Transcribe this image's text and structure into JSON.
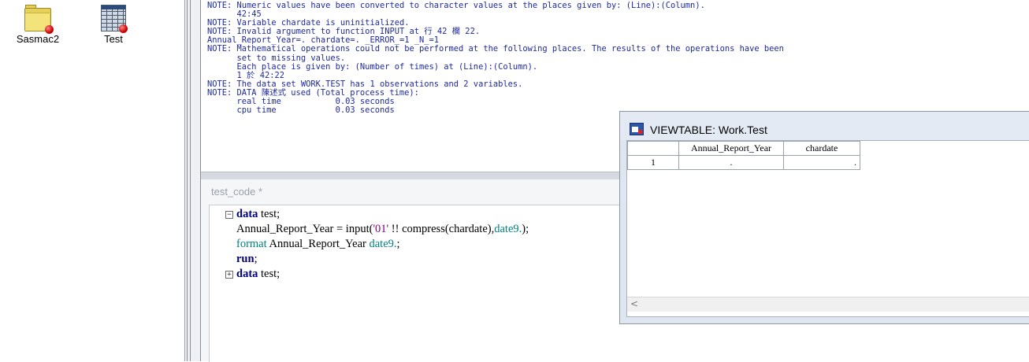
{
  "explorer": {
    "items": [
      {
        "label": "Sasmac2",
        "icon": "folder-library-icon"
      },
      {
        "label": "Test",
        "icon": "table-dataset-icon"
      }
    ]
  },
  "log": {
    "lines": [
      "NOTE: Numeric values have been converted to character values at the places given by: (Line):(Column).",
      "      42:45",
      "NOTE: Variable chardate is uninitialized.",
      "NOTE: Invalid argument to function INPUT at 行 42 欄 22.",
      "Annual_Report_Year=. chardate=. _ERROR_=1 _N_=1",
      "NOTE: Mathematical operations could not be performed at the following places. The results of the operations have been",
      "      set to missing values.",
      "      Each place is given by: (Number of times) at (Line):(Column).",
      "      1 於 42:22",
      "NOTE: The data set WORK.TEST has 1 observations and 2 variables.",
      "NOTE: DATA 陳述式 used (Total process time):",
      "      real time           0.03 seconds",
      "      cpu time            0.03 seconds"
    ]
  },
  "editor": {
    "title": "test_code *",
    "lines": {
      "l1_kw": "data",
      "l1_rest": " test;",
      "l2_a": "Annual_Report_Year = input(",
      "l2_str": "'01'",
      "l2_b": " !! compress(chardate),",
      "l2_fmt": "date9.",
      "l2_c": ");",
      "l3_kw": "format",
      "l3_a": " Annual_Report_Year ",
      "l3_fmt": "date9.",
      "l3_c": ";",
      "l4_kw": "run",
      "l4_c": ";",
      "l5_kw": "data",
      "l5_rest": " test;"
    },
    "fold_minus": "−",
    "fold_plus": "+"
  },
  "viewtable": {
    "title": "VIEWTABLE: Work.Test",
    "columns": [
      "Annual_Report_Year",
      "chardate"
    ],
    "rows": [
      {
        "num": "1",
        "cells": [
          ".",
          "."
        ]
      }
    ],
    "scroll_left": "<"
  },
  "colors": {
    "log_text": "#1e2a9e",
    "keyword": "#000080",
    "format": "#008080",
    "string": "#800080"
  }
}
